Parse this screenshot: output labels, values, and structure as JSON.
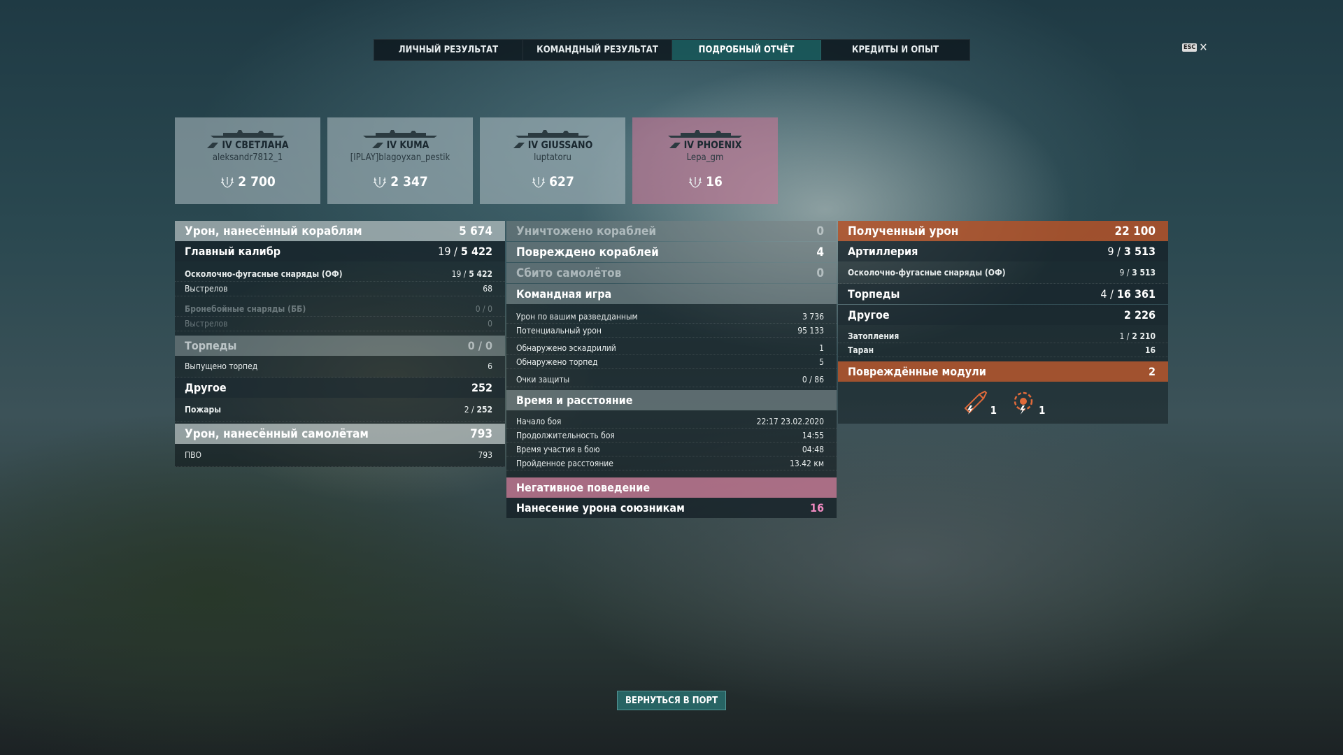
{
  "tabs": [
    "ЛИЧНЫЙ РЕЗУЛЬТАТ",
    "КОМАНДНЫЙ РЕЗУЛЬТАТ",
    "ПОДРОБНЫЙ ОТЧЁТ",
    "КРЕДИТЫ И ОПЫТ"
  ],
  "active_tab": 2,
  "esc": {
    "key": "ESC",
    "close": "✕"
  },
  "cards": [
    {
      "ship": "IV СВЕТЛАНА",
      "player": "aleksandr7812_1",
      "score": "2 700"
    },
    {
      "ship": "IV KUMA",
      "player": "[IPLAY]blagoyxan_pestik",
      "score": "2 347"
    },
    {
      "ship": "IV GIUSSANO",
      "player": "luptatoru",
      "score": "627"
    },
    {
      "ship": "IV PHOENIX",
      "player": "Lepa_gm",
      "score": "16"
    }
  ],
  "left": {
    "ship_damage": {
      "label": "Урон, нанесённый кораблям",
      "value": "5 674"
    },
    "main_battery": {
      "label": "Главный калибр",
      "hits": "19 /",
      "value": "5 422"
    },
    "he": {
      "label": "Осколочно-фугасные снаряды (ОФ)",
      "hits": "19 /",
      "value": "5 422"
    },
    "he_shots": {
      "label": "Выстрелов",
      "value": "68"
    },
    "ap": {
      "label": "Бронебойные снаряды (ББ)",
      "value": "0 / 0"
    },
    "ap_shots": {
      "label": "Выстрелов",
      "value": "0"
    },
    "torps": {
      "label": "Торпеды",
      "value": "0 / 0"
    },
    "torps_fired": {
      "label": "Выпущено торпед",
      "value": "6"
    },
    "other": {
      "label": "Другое",
      "value": "252"
    },
    "fires": {
      "label": "Пожары",
      "hits": "2 /",
      "value": "252"
    },
    "plane_damage": {
      "label": "Урон, нанесённый самолётам",
      "value": "793"
    },
    "aa": {
      "label": "ПВО",
      "value": "793"
    }
  },
  "mid": {
    "destroyed": {
      "label": "Уничтожено кораблей",
      "value": "0"
    },
    "damaged": {
      "label": "Повреждено кораблей",
      "value": "4"
    },
    "planes": {
      "label": "Сбито самолётов",
      "value": "0"
    },
    "team": {
      "label": "Командная игра"
    },
    "spot_dmg": {
      "label": "Урон по вашим разведданным",
      "value": "3 736"
    },
    "potential": {
      "label": "Потенциальный урон",
      "value": "95 133"
    },
    "squadrons": {
      "label": "Обнаружено эскадрилий",
      "value": "1"
    },
    "torp_spot": {
      "label": "Обнаружено торпед",
      "value": "5"
    },
    "defense": {
      "label": "Очки защиты",
      "value": "0 / 86"
    },
    "time": {
      "label": "Время и расстояние"
    },
    "start": {
      "label": "Начало боя",
      "value": "22:17  23.02.2020"
    },
    "duration": {
      "label": "Продолжительность боя",
      "value": "14:55"
    },
    "participation": {
      "label": "Время участия в бою",
      "value": "04:48"
    },
    "distance": {
      "label": "Пройденное расстояние",
      "value": "13.42 км"
    },
    "negative": {
      "label": "Негативное поведение"
    },
    "ally_damage": {
      "label": "Нанесение урона союзникам",
      "value": "16"
    }
  },
  "right": {
    "received": {
      "label": "Полученный урон",
      "value": "22 100"
    },
    "artillery": {
      "label": "Артиллерия",
      "hits": "9 /",
      "value": "3 513"
    },
    "he": {
      "label": "Осколочно-фугасные снаряды (ОФ)",
      "hits": "9 /",
      "value": "3 513"
    },
    "torps": {
      "label": "Торпеды",
      "hits": "4 /",
      "value": "16 361"
    },
    "other": {
      "label": "Другое",
      "value": "2 226"
    },
    "flooding": {
      "label": "Затопления",
      "hits": "1 /",
      "value": "2 210"
    },
    "ram": {
      "label": "Таран",
      "value": "16"
    },
    "modules": {
      "label": "Повреждённые модули",
      "value": "2"
    },
    "module_counts": [
      "1",
      "1"
    ]
  },
  "back_button": "ВЕРНУТЬСЯ В ПОРТ"
}
